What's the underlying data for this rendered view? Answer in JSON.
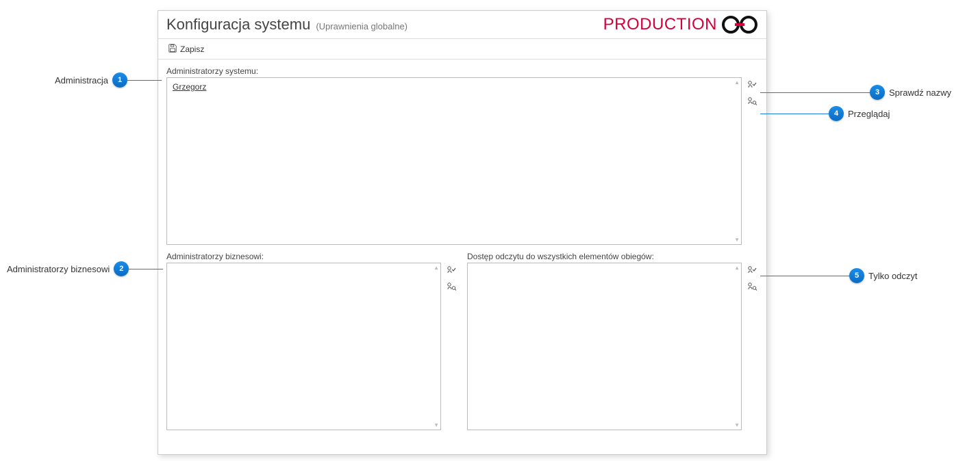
{
  "header": {
    "title": "Konfiguracja systemu",
    "subtitle": "(Uprawnienia globalne)",
    "env": "PRODUCTION"
  },
  "toolbar": {
    "save_label": "Zapisz"
  },
  "sections": {
    "system_admins": {
      "label": "Administratorzy systemu:",
      "entries": [
        "Grzegorz"
      ]
    },
    "business_admins": {
      "label": "Administratorzy biznesowi:",
      "entries": []
    },
    "read_access": {
      "label": "Dostęp odczytu do wszystkich elementów obiegów:",
      "entries": []
    }
  },
  "callouts": {
    "c1": {
      "num": "1",
      "text": "Administracja"
    },
    "c2": {
      "num": "2",
      "text": "Administratorzy biznesowi"
    },
    "c3": {
      "num": "3",
      "text": "Sprawdź nazwy"
    },
    "c4": {
      "num": "4",
      "text": "Przeglądaj"
    },
    "c5": {
      "num": "5",
      "text": "Tylko odczyt"
    }
  }
}
